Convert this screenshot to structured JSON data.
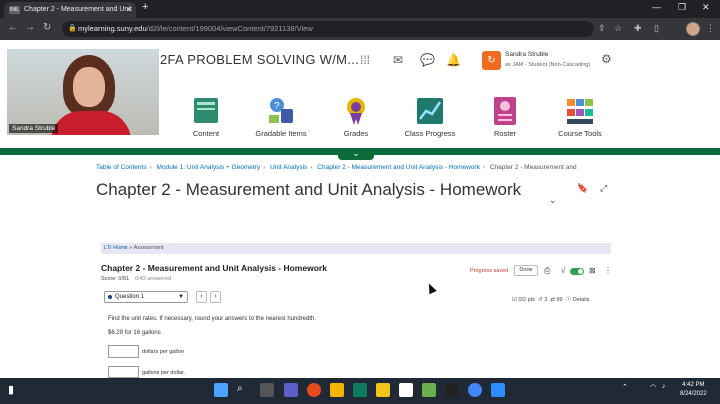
{
  "browser": {
    "tab_title": "Chapter 2 - Measurement and Unit",
    "favicon_text": "INIL",
    "url_domain": "mylearning.suny.edu",
    "url_path": "/d2l/le/content/199004/viewContent/7921138/View",
    "tab_close": "×",
    "new_tab": "+"
  },
  "header": {
    "course_title": "2FA PROBLEM SOLVING W/M...",
    "user_name": "Sandra Struble",
    "user_role": "as JAM - Student (Non-Cascading)"
  },
  "nav": {
    "items": [
      {
        "label": "Content",
        "icon": "content-icon"
      },
      {
        "label": "Gradable Items",
        "icon": "gradable-items-icon"
      },
      {
        "label": "Grades",
        "icon": "grades-icon"
      },
      {
        "label": "Class Progress",
        "icon": "class-progress-icon"
      },
      {
        "label": "Roster",
        "icon": "roster-icon"
      },
      {
        "label": "Course Tools",
        "icon": "course-tools-icon"
      }
    ]
  },
  "breadcrumb": {
    "items": [
      "Table of Contents",
      "Module 1: Unit Analysis + Geometry",
      "Unit Analysis",
      "Chapter 2 - Measurement and Unit Analysis - Homework",
      "Chapter 2 - Measurement and"
    ]
  },
  "page": {
    "title": "Chapter 2 - Measurement and Unit Analysis - Homework"
  },
  "lti": {
    "home_link": "LTI Home",
    "separator": "»",
    "current": "Assessment"
  },
  "assignment": {
    "title": "Chapter 2 - Measurement and Unit Analysis - Homework",
    "score": "Score: 0/81",
    "answered": "0/43 answered",
    "progress_status": "Progress saved",
    "done_label": "Done",
    "question_selector": "Question 1",
    "points": "0/2 pts",
    "attempts": "3",
    "retries": "99",
    "details_label": "Details",
    "instructions": "Find the unit rates. If necessary, round your answers to the nearest hundredth.",
    "rate_amount": "$6.29",
    "rate_text": "for 16 gallons",
    "answer1_label": "dollars per gallon",
    "answer2_label": "gallons per dollar."
  },
  "webcam": {
    "name": "Sandra Struble"
  },
  "taskbar": {
    "time": "4:42 PM",
    "date": "8/24/2022"
  },
  "colors": {
    "brand_green": "#0b6b3a",
    "link_blue": "#006fbf",
    "progress_red": "#c0392b",
    "user_orange": "#f26a21"
  }
}
